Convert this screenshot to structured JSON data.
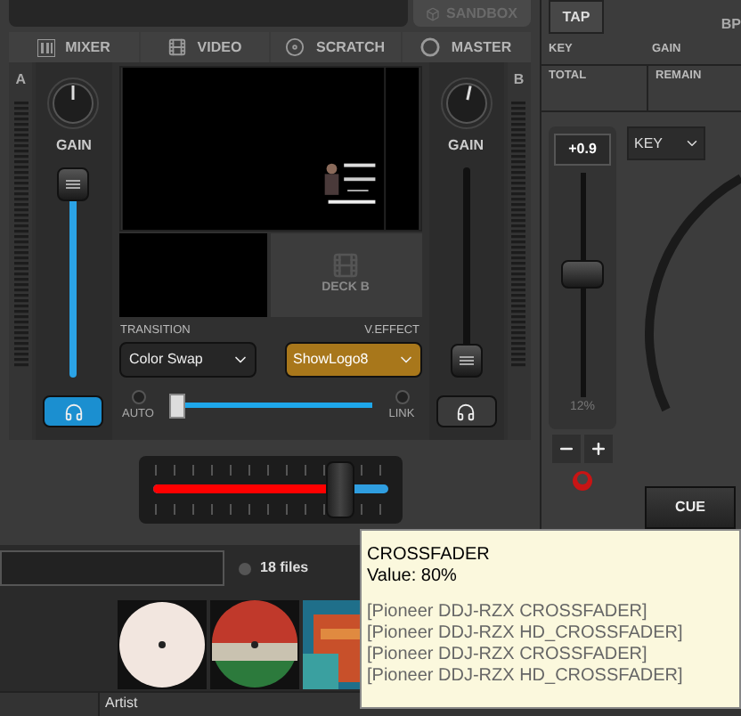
{
  "top_bar": {
    "sandbox_button": "SANDBOX",
    "tap_button": "TAP",
    "bpm_label": "BP"
  },
  "tabs": [
    {
      "label": "MIXER",
      "kind": "mixer",
      "selected": false
    },
    {
      "label": "VIDEO",
      "kind": "video",
      "selected": false
    },
    {
      "label": "SCRATCH",
      "kind": "scratch",
      "selected": false
    },
    {
      "label": "MASTER",
      "kind": "master",
      "selected": false
    }
  ],
  "info": {
    "key_label": "KEY",
    "gain_label": "GAIN",
    "total_label": "TOTAL",
    "remain_label": "REMAIN"
  },
  "decks": [
    {
      "letter": "A",
      "gain_label": "GAIN",
      "level": 0.95,
      "pfl_on": true
    },
    {
      "letter": "B",
      "gain_label": "GAIN",
      "level": 0.08,
      "pfl_on": false
    }
  ],
  "video": {
    "deck_b_label": "DECK B",
    "transition_label": "TRANSITION",
    "transition_value": "Color Swap",
    "effect_label": "V.EFFECT",
    "effect_value": "ShowLogo8",
    "auto_label": "AUTO",
    "link_label": "LINK",
    "level": 0.02
  },
  "crossfader": {
    "level": 0.8
  },
  "pitch": {
    "value": "+0.9",
    "percent": "12%",
    "level": 0.55,
    "key_button": "KEY",
    "cue_button": "CUE"
  },
  "browser": {
    "file_count": "18 files",
    "covers": [
      {
        "kind": "picture"
      },
      {
        "kind": "picture"
      },
      {
        "kind": "picture"
      }
    ],
    "columns": [
      "Artist"
    ]
  },
  "tooltip": {
    "title": "CROSSFADER",
    "value": "Value: 80%",
    "mappings": [
      "[Pioneer DDJ-RZX CROSSFADER]",
      "[Pioneer DDJ-RZX HD_CROSSFADER]",
      "[Pioneer DDJ-RZX CROSSFADER]",
      "[Pioneer DDJ-RZX HD_CROSSFADER]"
    ]
  }
}
